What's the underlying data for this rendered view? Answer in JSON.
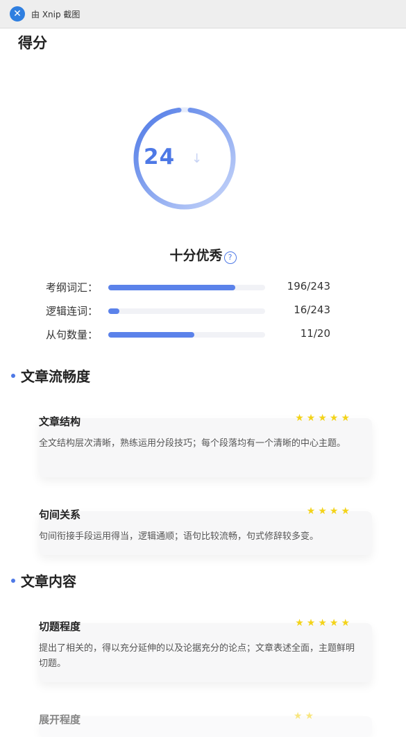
{
  "app": {
    "window_title": "由 Xnip 截图"
  },
  "page": {
    "title": "得分"
  },
  "score": {
    "value": "24",
    "faint_char": "↓",
    "ring_color": "#4e79e6",
    "grade": "十分优秀",
    "help_glyph": "?"
  },
  "metrics": [
    {
      "label": "考纲词汇：",
      "value": "196/243",
      "progress": 0.81
    },
    {
      "label": "逻辑连词：",
      "value": "16/243",
      "progress": 0.07
    },
    {
      "label": "从句数量：",
      "value": "11/20",
      "progress": 0.55
    }
  ],
  "sections": [
    {
      "title": "文章流畅度",
      "cards": [
        {
          "title": "文章结构",
          "stars": "★★★★★",
          "desc": "全文结构层次清晰，熟练运用分段技巧；每个段落均有一个清晰的中心主题。"
        },
        {
          "title": "句间关系",
          "stars": "★★★★",
          "desc": "句间衔接手段运用得当，逻辑通顺；语句比较流畅，句式修辞较多变。"
        }
      ]
    },
    {
      "title": "文章内容",
      "cards": [
        {
          "title": "切题程度",
          "stars": "★★★★★",
          "desc": "提出了相关的，得以充分延伸的以及论据充分的论点；文章表述全面，主题鲜明切题。"
        },
        {
          "title": "展开程度",
          "stars": "★★",
          "desc": ""
        }
      ]
    }
  ],
  "colors": {
    "accent": "#4e79e6",
    "star": "#f3d31a",
    "card_bg": "#f7f7f8"
  }
}
